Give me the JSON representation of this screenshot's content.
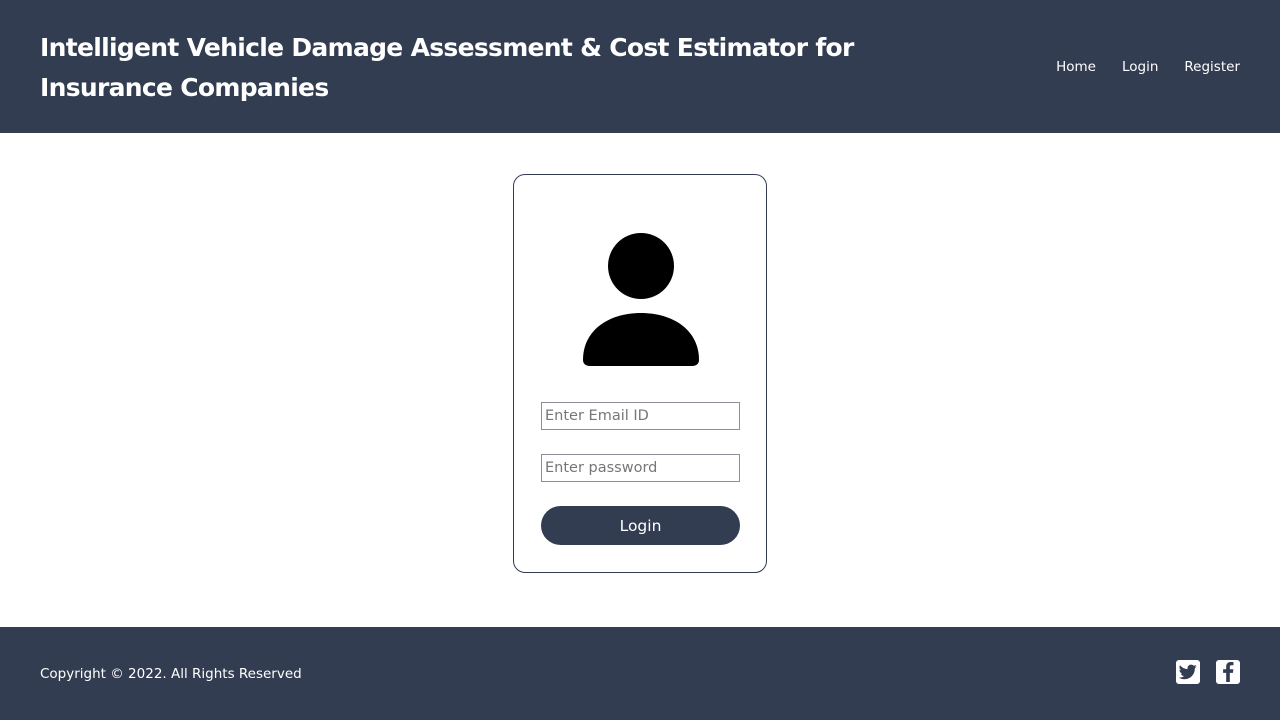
{
  "header": {
    "title": "Intelligent Vehicle Damage Assessment & Cost Estimator for Insurance Companies",
    "nav": [
      {
        "label": "Home"
      },
      {
        "label": "Login"
      },
      {
        "label": "Register"
      }
    ]
  },
  "login_form": {
    "avatar_icon": "user-icon",
    "email": {
      "placeholder": "Enter Email ID",
      "value": ""
    },
    "password": {
      "placeholder": "Enter password",
      "value": ""
    },
    "submit_label": "Login"
  },
  "footer": {
    "copyright": "Copyright © 2022. All Rights Reserved",
    "social": [
      {
        "icon": "twitter-icon"
      },
      {
        "icon": "facebook-icon"
      }
    ]
  },
  "colors": {
    "brand": "#333d51",
    "background": "#ffffff",
    "text_on_brand": "#ffffff"
  }
}
